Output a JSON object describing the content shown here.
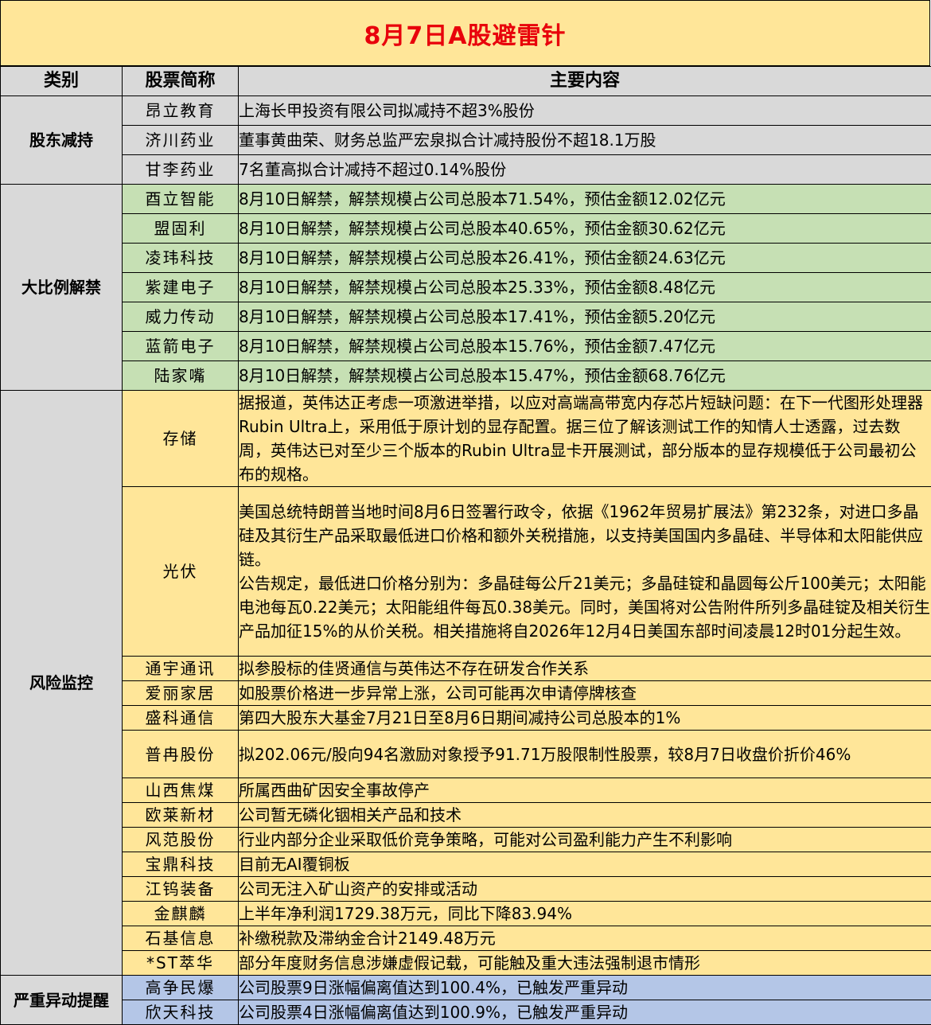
{
  "title": "8月7日A股避雷针",
  "headers": {
    "category": "类别",
    "name": "股票简称",
    "content": "主要内容"
  },
  "sections": [
    {
      "category": "股东减持",
      "rows": [
        {
          "name": "昂立教育",
          "content": "上海长甲投资有限公司拟减持不超3%股份"
        },
        {
          "name": "济川药业",
          "content": "董事黄曲荣、财务总监严宏泉拟合计减持股份不超18.1万股"
        },
        {
          "name": "甘李药业",
          "content": "7名董高拟合计减持不超过0.14%股份"
        }
      ]
    },
    {
      "category": "大比例解禁",
      "rows": [
        {
          "name": "酉立智能",
          "content": "8月10日解禁，解禁规模占公司总股本71.54%，预估金额12.02亿元"
        },
        {
          "name": "盟固利",
          "content": "8月10日解禁，解禁规模占公司总股本40.65%，预估金额30.62亿元"
        },
        {
          "name": "凌玮科技",
          "content": "8月10日解禁，解禁规模占公司总股本26.41%，预估金额24.63亿元"
        },
        {
          "name": "紫建电子",
          "content": "8月10日解禁，解禁规模占公司总股本25.33%，预估金额8.48亿元"
        },
        {
          "name": "威力传动",
          "content": "8月10日解禁，解禁规模占公司总股本17.41%，预估金额5.20亿元"
        },
        {
          "name": "蓝箭电子",
          "content": "8月10日解禁，解禁规模占公司总股本15.76%，预估金额7.47亿元"
        },
        {
          "name": "陆家嘴",
          "content": "8月10日解禁，解禁规模占公司总股本15.47%，预估金额68.76亿元"
        }
      ]
    },
    {
      "category": "风险监控",
      "rows": [
        {
          "name": "存储",
          "content": "据报道，英伟达正考虑一项激进举措，以应对高端高带宽内存芯片短缺问题：在下一代图形处理器Rubin Ultra上，采用低于原计划的显存配置。据三位了解该测试工作的知情人士透露，过去数周，英伟达已对至少三个版本的Rubin Ultra显卡开展测试，部分版本的显存规模低于公司最初公布的规格。"
        },
        {
          "name": "光伏",
          "content": "美国总统特朗普当地时间8月6日签署行政令，依据《1962年贸易扩展法》第232条，对进口多晶硅及其衍生产品采取最低进口价格和额外关税措施，以支持美国国内多晶硅、半导体和太阳能供应链。",
          "content2": "公告规定，最低进口价格分别为：多晶硅每公斤21美元；多晶硅锭和晶圆每公斤100美元；太阳能电池每瓦0.22美元；太阳能组件每瓦0.38美元。同时，美国将对公告附件所列多晶硅锭及相关衍生产品加征15%的从价关税。相关措施将自2026年12月4日美国东部时间凌晨12时01分起生效。"
        },
        {
          "name": "通宇通讯",
          "content": "拟参股标的佳贤通信与英伟达不存在研发合作关系"
        },
        {
          "name": "爱丽家居",
          "content": "如股票价格进一步异常上涨，公司可能再次申请停牌核查"
        },
        {
          "name": "盛科通信",
          "content": "第四大股东大基金7月21日至8月6日期间减持公司总股本的1%"
        },
        {
          "name": "普冉股份",
          "content": "拟202.06元/股向94名激励对象授予91.71万股限制性股票，较8月7日收盘价折价46%"
        },
        {
          "name": "山西焦煤",
          "content": "所属西曲矿因安全事故停产"
        },
        {
          "name": "欧莱新材",
          "content": "公司暂无磷化铟相关产品和技术"
        },
        {
          "name": "风范股份",
          "content": "行业内部分企业采取低价竞争策略，可能对公司盈利能力产生不利影响"
        },
        {
          "name": "宝鼎科技",
          "content": "目前无AI覆铜板"
        },
        {
          "name": "江钨装备",
          "content": "公司无注入矿山资产的安排或活动"
        },
        {
          "name": "金麒麟",
          "content": "上半年净利润1729.38万元，同比下降83.94%"
        },
        {
          "name": "石基信息",
          "content": "补缴税款及滞纳金合计2149.48万元"
        },
        {
          "name": "*ST萃华",
          "content": "部分年度财务信息涉嫌虚假记载，可能触及重大违法强制退市情形"
        }
      ]
    },
    {
      "category": "严重异动提醒",
      "rows": [
        {
          "name": "高争民爆",
          "content": "公司股票9日涨幅偏离值达到100.4%，已触发严重异动"
        },
        {
          "name": "欣天科技",
          "content": "公司股票4日涨幅偏离值达到100.9%，已触发严重异动"
        }
      ]
    }
  ],
  "colors": {
    "title_bg": "#FFE699",
    "title_text": "#E8000B",
    "header_bg": "#D9D9D9",
    "category_text": "#E8000B",
    "gray": "#D9D9D9",
    "green": "#C6E0B4",
    "yellow": "#FFE699",
    "blue": "#B4C6E7"
  }
}
